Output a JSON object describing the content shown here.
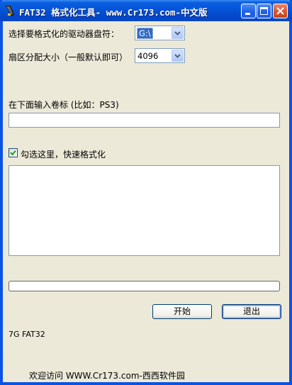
{
  "window": {
    "title": "FAT32 格式化工具- www.Cr173.com-中文版"
  },
  "drive": {
    "label": "选择要格式化的驱动器盘符：",
    "selected": "G:\\"
  },
  "cluster": {
    "label": "扇区分配大小（一般默认即可）",
    "selected": "4096"
  },
  "volume": {
    "label": "在下面输入卷标 (比如：PS3)",
    "value": ""
  },
  "quick_format": {
    "label": "勾选这里，快速格式化",
    "checked": true
  },
  "log": {
    "value": ""
  },
  "progress": {
    "value": 0
  },
  "buttons": {
    "start": "开始",
    "exit": "退出"
  },
  "status": {
    "text": "7G FAT32"
  },
  "footer": {
    "text": "欢迎访问 WWW.Cr173.com-西西软件园"
  },
  "colors": {
    "titlebar": "#0553d7",
    "window_bg": "#ece9d8",
    "selection": "#316ac5"
  }
}
